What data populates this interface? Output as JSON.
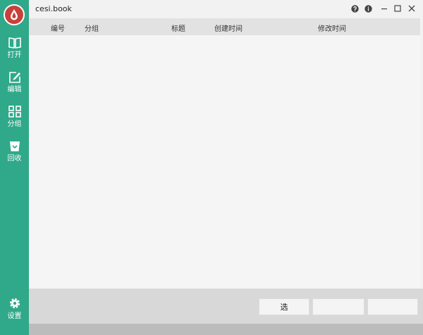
{
  "window": {
    "title": "cesi.book"
  },
  "sidebar": {
    "items": [
      {
        "id": "open",
        "label": "打开",
        "icon": "book-icon"
      },
      {
        "id": "edit",
        "label": "编辑",
        "icon": "edit-icon"
      },
      {
        "id": "group",
        "label": "分组",
        "icon": "grid-icon"
      },
      {
        "id": "recycle",
        "label": "回收",
        "icon": "recycle-bin-icon"
      }
    ],
    "settings_label": "设置"
  },
  "table": {
    "columns": [
      "编号",
      "分组",
      "标题",
      "创建时间",
      "修改时间"
    ],
    "rows": []
  },
  "footer": {
    "buttons": [
      "选"
    ]
  },
  "colors": {
    "sidebar": "#2fa98a",
    "logo": "#c8413b",
    "background": "#f2f2f2",
    "header": "#e2e2e2",
    "footer": "#d8d8d8"
  }
}
